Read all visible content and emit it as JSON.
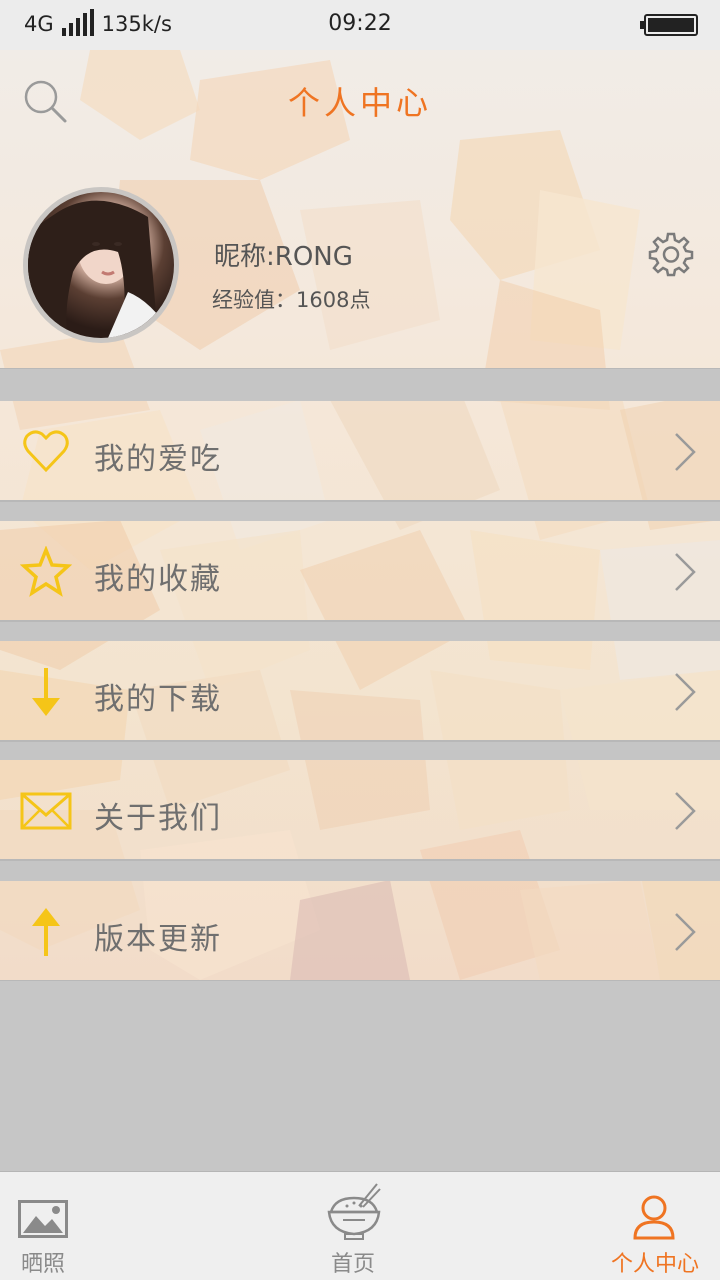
{
  "status_bar": {
    "network": "4G",
    "speed": "135k/s",
    "time": "09:22"
  },
  "header": {
    "title": "个人中心"
  },
  "profile": {
    "nickname": "昵称:RONG",
    "experience": "经验值：1608点"
  },
  "menu": [
    {
      "label": "我的爱吃",
      "icon": "heart-icon"
    },
    {
      "label": "我的收藏",
      "icon": "star-icon"
    },
    {
      "label": "我的下载",
      "icon": "download-arrow-icon"
    },
    {
      "label": "关于我们",
      "icon": "mail-icon"
    },
    {
      "label": "版本更新",
      "icon": "upload-arrow-icon"
    }
  ],
  "tabbar": {
    "photo_label": "晒照",
    "home_label": "首页",
    "profile_label": "个人中心"
  },
  "colors": {
    "accent": "#ef7422",
    "icon_yellow": "#f5c518",
    "tab_inactive": "#8a8a8a"
  }
}
